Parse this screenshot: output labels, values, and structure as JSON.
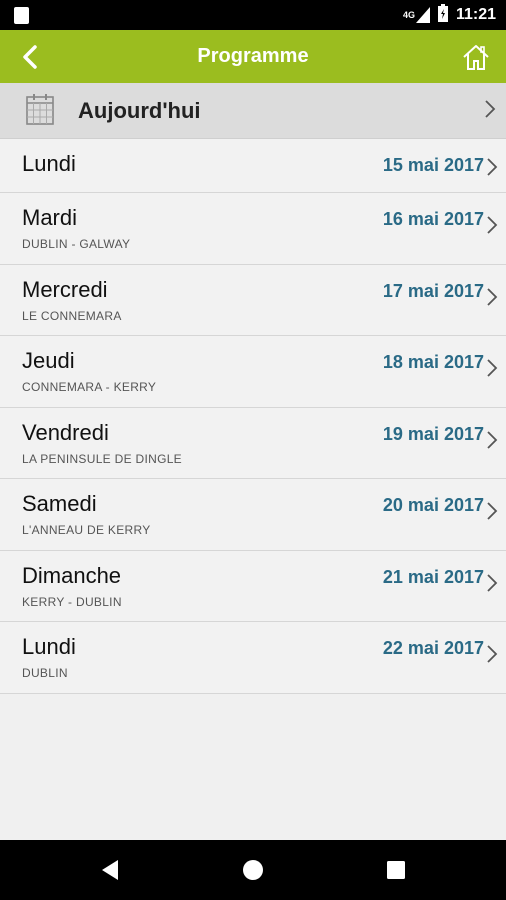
{
  "status_bar": {
    "signal_label": "4G",
    "time": "11:21"
  },
  "header": {
    "title": "Programme"
  },
  "today": {
    "label": "Aujourd'hui"
  },
  "days": [
    {
      "day": "Lundi",
      "subtitle": "",
      "date": "15 mai 2017"
    },
    {
      "day": "Mardi",
      "subtitle": "DUBLIN - GALWAY",
      "date": "16 mai 2017"
    },
    {
      "day": "Mercredi",
      "subtitle": "LE CONNEMARA",
      "date": "17 mai 2017"
    },
    {
      "day": "Jeudi",
      "subtitle": "CONNEMARA - KERRY",
      "date": "18 mai 2017"
    },
    {
      "day": "Vendredi",
      "subtitle": "LA PENINSULE DE DINGLE",
      "date": "19 mai 2017"
    },
    {
      "day": "Samedi",
      "subtitle": "L'ANNEAU DE KERRY",
      "date": "20 mai 2017"
    },
    {
      "day": "Dimanche",
      "subtitle": "KERRY - DUBLIN",
      "date": "21 mai 2017"
    },
    {
      "day": "Lundi",
      "subtitle": "DUBLIN",
      "date": "22 mai 2017"
    }
  ],
  "colors": {
    "header": "#9bbd1f",
    "date": "#2a6a86"
  }
}
